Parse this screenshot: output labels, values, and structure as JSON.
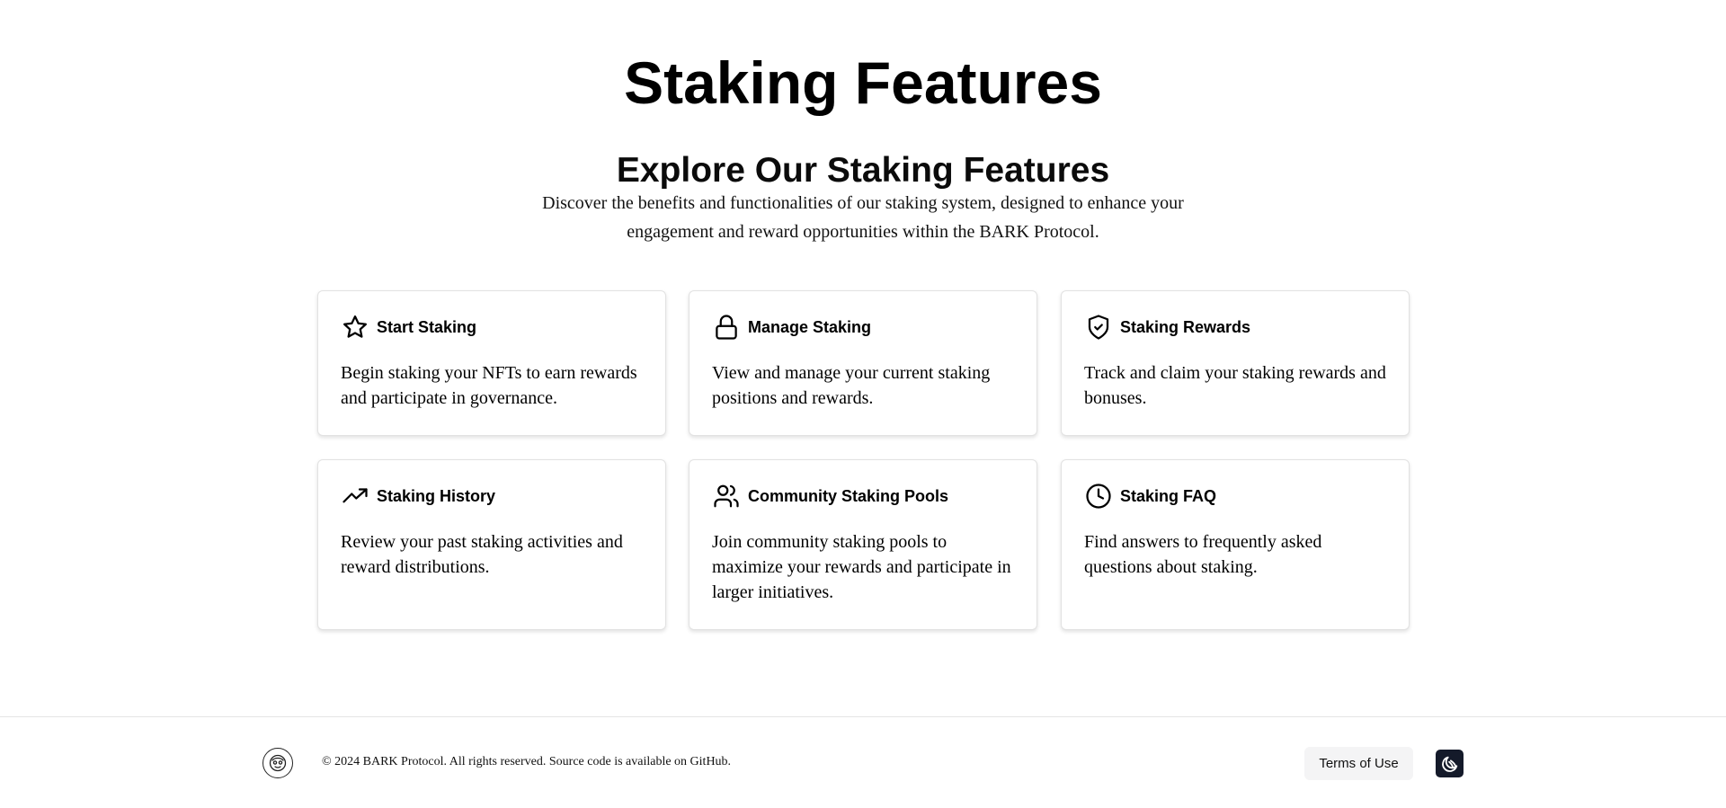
{
  "header": {
    "title": "Staking Features"
  },
  "intro": {
    "title": "Explore Our Staking Features",
    "description": "Discover the benefits and functionalities of our staking system, designed to enhance your engagement and reward opportunities within the BARK Protocol."
  },
  "features": [
    {
      "icon": "star-icon",
      "title": "Start Staking",
      "description": "Begin staking your NFTs to earn rewards and participate in governance."
    },
    {
      "icon": "lock-icon",
      "title": "Manage Staking",
      "description": "View and manage your current staking positions and rewards."
    },
    {
      "icon": "shield-check-icon",
      "title": "Staking Rewards",
      "description": "Track and claim your staking rewards and bonuses."
    },
    {
      "icon": "trending-up-icon",
      "title": "Staking History",
      "description": "Review your past staking activities and reward distributions."
    },
    {
      "icon": "users-icon",
      "title": "Community Staking Pools",
      "description": "Join community staking pools to maximize your rewards and participate in larger initiatives."
    },
    {
      "icon": "clock-icon",
      "title": "Staking FAQ",
      "description": "Find answers to frequently asked questions about staking."
    }
  ],
  "footer": {
    "copyright": "© 2024 BARK Protocol. All rights reserved. Source code is available on GitHub.",
    "terms_label": "Terms of Use",
    "logo_icon": "bark-logo-icon",
    "theme_icon": "theme-toggle-icon"
  }
}
